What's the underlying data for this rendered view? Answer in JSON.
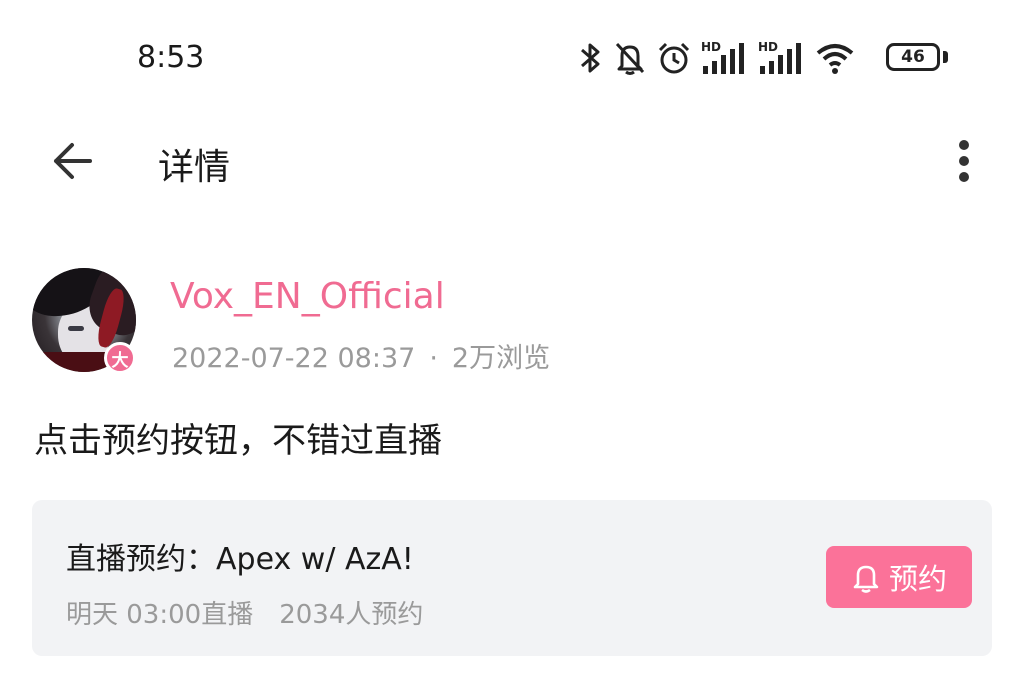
{
  "status_bar": {
    "time": "8:53",
    "network_label_1": "HD",
    "network_label_2": "HD",
    "battery": "46",
    "icons": [
      "bluetooth-icon",
      "mute-bell-icon",
      "alarm-icon",
      "signal-hd-icon",
      "signal-hd-icon",
      "wifi-icon",
      "battery-icon"
    ]
  },
  "header": {
    "title": "详情",
    "back_icon": "back-arrow-icon",
    "more_icon": "more-vertical-icon"
  },
  "post": {
    "author": "Vox_EN_Official",
    "badge": "大",
    "date": "2022-07-22 08:37",
    "separator": "·",
    "views": "2万浏览",
    "text": "点击预约按钮，不错过直播"
  },
  "reservation": {
    "title": "直播预约：Apex w/ AzA!",
    "time": "明天 03:00直播",
    "count": "2034人预约",
    "button_label": "预约",
    "button_icon": "bell-icon"
  },
  "colors": {
    "accent_pink": "#fb7299",
    "author_pink": "#f06b92",
    "card_bg": "#f2f3f5",
    "meta_gray": "#9a9a9a"
  }
}
